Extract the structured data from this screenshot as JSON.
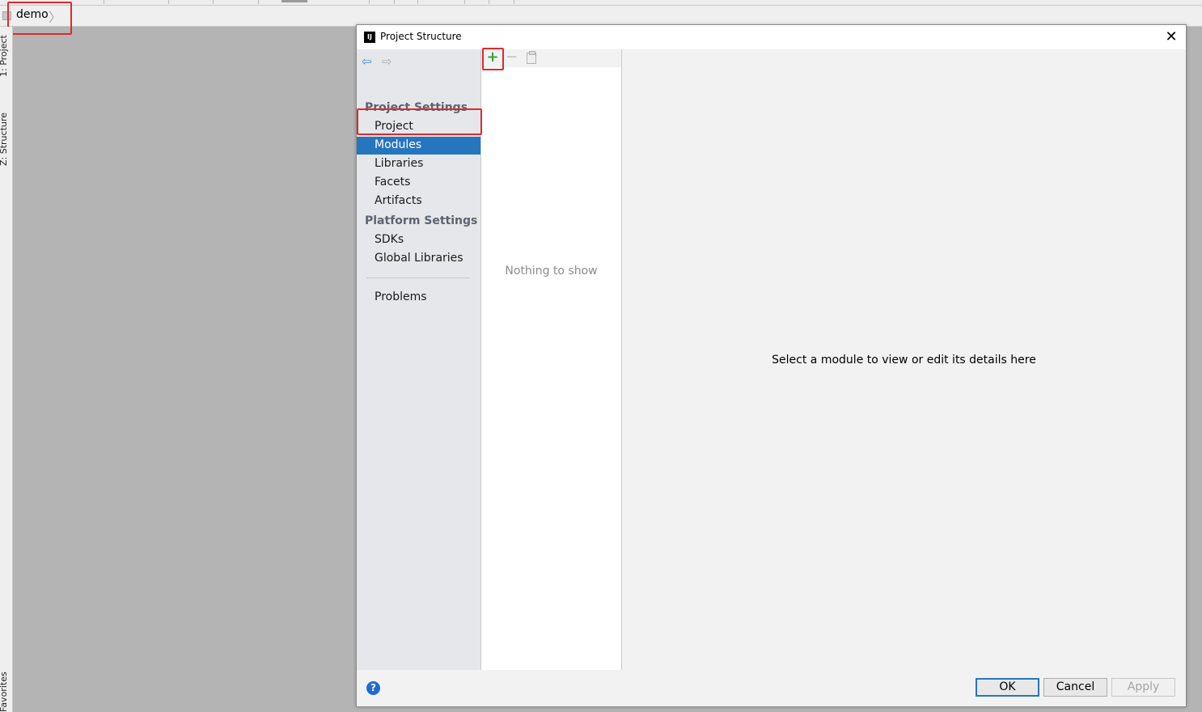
{
  "navbar": {
    "crumb": "demo"
  },
  "left_strip": {
    "tabs": [
      "1: Project",
      "Z: Structure",
      "Favorites"
    ]
  },
  "dialog": {
    "title": "Project Structure",
    "app_icon": "IJ",
    "close": "✕",
    "sidebar": {
      "back_icon": "arrow-left-icon",
      "forward_icon": "arrow-right-icon",
      "project_settings_header": "Project Settings",
      "project_items": [
        "Project",
        "Modules",
        "Libraries",
        "Facets",
        "Artifacts"
      ],
      "platform_settings_header": "Platform Settings",
      "platform_items": [
        "SDKs",
        "Global Libraries"
      ],
      "problems": "Problems",
      "selected": "Modules"
    },
    "middle": {
      "add": "+",
      "remove": "−",
      "empty_text": "Nothing to show"
    },
    "detail": {
      "message": "Select a module to view or edit its details here"
    },
    "footer": {
      "help": "?",
      "ok": "OK",
      "cancel": "Cancel",
      "apply": "Apply"
    }
  },
  "colors": {
    "selection": "#2675bf",
    "annotation": "#e0292a",
    "add_icon": "#3aa33a"
  }
}
